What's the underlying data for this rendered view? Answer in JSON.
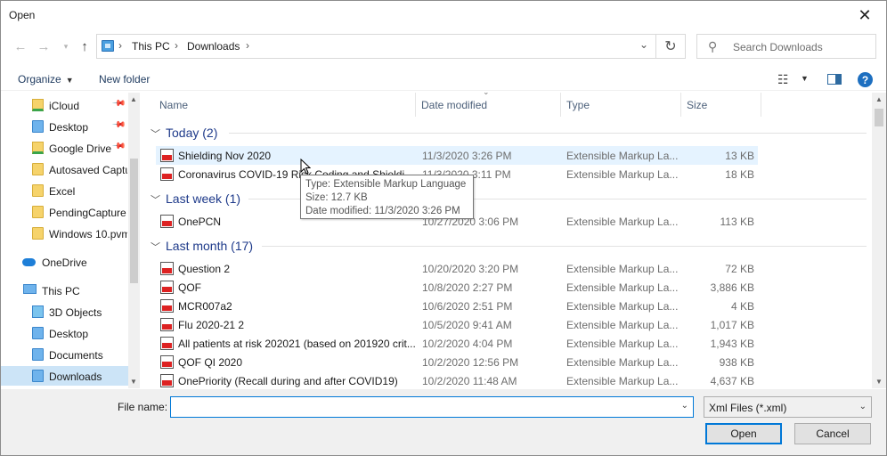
{
  "window": {
    "title": "Open"
  },
  "address": {
    "crumbs": [
      "This PC",
      "Downloads"
    ]
  },
  "search": {
    "placeholder": "Search Downloads"
  },
  "toolbar": {
    "organize": "Organize",
    "new_folder": "New folder"
  },
  "nav": {
    "items": [
      {
        "label": "iCloud",
        "icon": "icloud-folder-icon",
        "pinned": true
      },
      {
        "label": "Desktop",
        "icon": "desktop-folder-icon",
        "pinned": true
      },
      {
        "label": "Google Drive",
        "icon": "google-drive-folder-icon",
        "pinned": true
      },
      {
        "label": "Autosaved Captu",
        "icon": "folder-icon"
      },
      {
        "label": "Excel",
        "icon": "folder-icon"
      },
      {
        "label": "PendingCapture",
        "icon": "folder-icon"
      },
      {
        "label": "Windows 10.pvm",
        "icon": "folder-icon"
      },
      {
        "label": "OneDrive",
        "icon": "onedrive-icon"
      },
      {
        "label": "This PC",
        "icon": "this-pc-icon"
      },
      {
        "label": "3D Objects",
        "icon": "3d-objects-icon"
      },
      {
        "label": "Desktop",
        "icon": "desktop-folder-icon"
      },
      {
        "label": "Documents",
        "icon": "documents-folder-icon"
      },
      {
        "label": "Downloads",
        "icon": "downloads-folder-icon",
        "selected": true
      }
    ]
  },
  "columns": {
    "name": "Name",
    "date": "Date modified",
    "type": "Type",
    "size": "Size"
  },
  "groups": [
    {
      "label": "Today (2)",
      "files": [
        {
          "name": "Shielding Nov 2020",
          "date": "11/3/2020 3:26 PM",
          "type": "Extensible Markup La...",
          "size": "13 KB"
        },
        {
          "name": "Coronavirus COVID-19 Risk Coding and Shieldi...",
          "date": "11/3/2020 3:11 PM",
          "type": "Extensible Markup La...",
          "size": "18 KB"
        }
      ]
    },
    {
      "label": "Last week (1)",
      "files": [
        {
          "name": "OnePCN",
          "date": "10/27/2020 3:06 PM",
          "type": "Extensible Markup La...",
          "size": "113 KB"
        }
      ]
    },
    {
      "label": "Last month (17)",
      "files": [
        {
          "name": "Question 2",
          "date": "10/20/2020 3:20 PM",
          "type": "Extensible Markup La...",
          "size": "72 KB"
        },
        {
          "name": "QOF",
          "date": "10/8/2020 2:27 PM",
          "type": "Extensible Markup La...",
          "size": "3,886 KB"
        },
        {
          "name": "MCR007a2",
          "date": "10/6/2020 2:51 PM",
          "type": "Extensible Markup La...",
          "size": "4 KB"
        },
        {
          "name": "Flu 2020-21 2",
          "date": "10/5/2020 9:41 AM",
          "type": "Extensible Markup La...",
          "size": "1,017 KB"
        },
        {
          "name": "All patients at risk 202021 (based on 201920 crit...",
          "date": "10/2/2020 4:04 PM",
          "type": "Extensible Markup La...",
          "size": "1,943 KB"
        },
        {
          "name": "QOF QI 2020",
          "date": "10/2/2020 12:56 PM",
          "type": "Extensible Markup La...",
          "size": "938 KB"
        },
        {
          "name": "OnePriority (Recall during and after COVID19)",
          "date": "10/2/2020 11:48 AM",
          "type": "Extensible Markup La...",
          "size": "4,637 KB"
        }
      ]
    }
  ],
  "tooltip": {
    "type": "Type: Extensible Markup Language",
    "size": "Size: 12.7 KB",
    "date": "Date modified: 11/3/2020 3:26 PM"
  },
  "bottom": {
    "filename_label": "File name:",
    "filename_value": "",
    "filter": "Xml Files (*.xml)",
    "open": "Open",
    "cancel": "Cancel"
  }
}
